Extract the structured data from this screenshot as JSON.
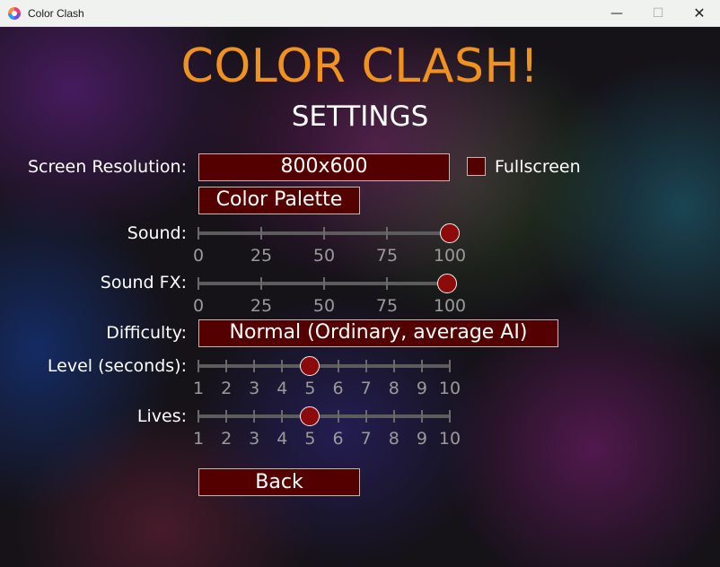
{
  "window": {
    "title": "Color Clash",
    "minimize": "—",
    "maximize": "☐",
    "close": "✕"
  },
  "game_title": "COLOR CLASH!",
  "page_title": "SETTINGS",
  "resolution": {
    "label": "Screen Resolution:",
    "value": "800x600"
  },
  "fullscreen": {
    "label": "Fullscreen",
    "checked": false
  },
  "color_palette": {
    "label": "Color Palette"
  },
  "sound": {
    "label": "Sound:",
    "value": 100,
    "min": 0,
    "max": 100,
    "ticks": [
      "0",
      "25",
      "50",
      "75",
      "100"
    ]
  },
  "sound_fx": {
    "label": "Sound FX:",
    "value": 99,
    "min": 0,
    "max": 100,
    "ticks": [
      "0",
      "25",
      "50",
      "75",
      "100"
    ]
  },
  "difficulty": {
    "label": "Difficulty:",
    "value": "Normal (Ordinary, average AI)"
  },
  "level": {
    "label": "Level (seconds):",
    "value": 5,
    "min": 1,
    "max": 10,
    "ticks": [
      "1",
      "2",
      "3",
      "4",
      "5",
      "6",
      "7",
      "8",
      "9",
      "10"
    ]
  },
  "lives": {
    "label": "Lives:",
    "value": 5,
    "min": 1,
    "max": 10,
    "ticks": [
      "1",
      "2",
      "3",
      "4",
      "5",
      "6",
      "7",
      "8",
      "9",
      "10"
    ]
  },
  "back": {
    "label": "Back"
  },
  "colors": {
    "title": "#f0921e",
    "field": "#550000",
    "knob": "#8c0a0a"
  }
}
